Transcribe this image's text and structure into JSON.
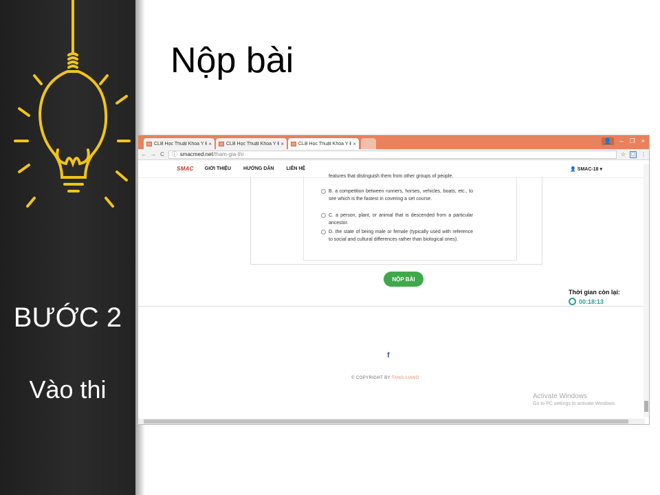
{
  "slide": {
    "title": "Nộp bài",
    "step_label": "BƯỚC 2",
    "step_name": "Vào thi"
  },
  "browser": {
    "tabs": [
      {
        "label": "CLB Học Thuật Khoa Y Đ",
        "close": "×"
      },
      {
        "label": "CLB Học Thuật Khoa Y Đ",
        "close": "×"
      },
      {
        "label": "CLB Học Thuật Khoa Y Đ",
        "close": "×"
      }
    ],
    "url_host": "smacmed.net",
    "url_path": "/tham-gia-thi",
    "window_controls": [
      "–",
      "❐",
      "×"
    ]
  },
  "site": {
    "logo": "SMAC",
    "nav": [
      "GIỚI THIỆU",
      "HƯỚNG DẪN",
      "LIÊN HỆ"
    ],
    "user": "SMAC-18"
  },
  "question": {
    "options": [
      {
        "text": "features that distinguish them from other groups of people.",
        "partial": true
      },
      {
        "text": "B. a competition between runners, horses, vehicles, boats, etc., to see which is the fastest in covering a set course."
      },
      {
        "text": "C. a person, plant, or animal that is descended from a particular ancestor."
      },
      {
        "text": "D. the state of being male or female (typically used with reference to social and cultural differences rather than biological ones)."
      }
    ]
  },
  "submit_label": "NỘP BÀI",
  "timer": {
    "label": "Thời gian còn lại:",
    "value": "00:18:13"
  },
  "footer": {
    "facebook": "f",
    "copyright": "© COPYRIGHT BY",
    "author": "TANG LIANG"
  },
  "watermark": {
    "line1": "Activate Windows",
    "line2": "Go to PC settings to activate Windows."
  },
  "colors": {
    "tab_bar": "#e8815c",
    "submit": "#3fa84a",
    "timer": "#26a09a",
    "bulb": "#f2c418"
  }
}
